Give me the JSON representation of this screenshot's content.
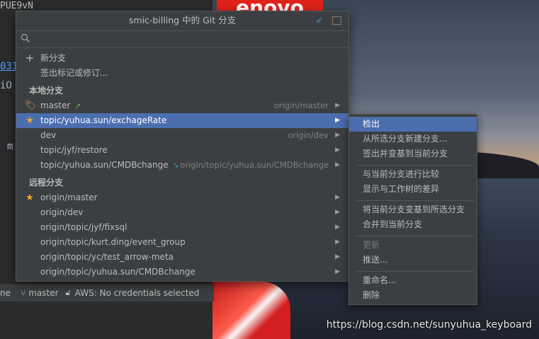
{
  "background": {
    "logo_text": "enovo",
    "ide_fragments": [
      "PUE9vN",
      "031",
      "iO",
      "m"
    ],
    "watermark": "https://blog.csdn.net/sunyuhua_keyboard"
  },
  "statusbar": {
    "left_fragment": "ne",
    "branch": "master",
    "aws": "AWS: No credentials selected"
  },
  "popup": {
    "title": "smic-billing 中的 Git 分支",
    "search": {
      "value": "",
      "placeholder": ""
    },
    "actions": [
      {
        "icon": "plus-icon",
        "label": "新分支"
      },
      {
        "icon": "none",
        "label": "签出标记或修订..."
      }
    ],
    "local_header": "本地分支",
    "local_branches": [
      {
        "icon": "tag-icon",
        "label": "master",
        "marker": "up-arrow-icon",
        "tracking": "origin/master"
      },
      {
        "icon": "star-icon",
        "label": "topic/yuhua.sun/exchageRate",
        "marker": "",
        "tracking": "",
        "selected": true
      },
      {
        "icon": "",
        "label": "dev",
        "marker": "",
        "tracking": "origin/dev"
      },
      {
        "icon": "",
        "label": "topic/jyf/restore",
        "marker": "",
        "tracking": ""
      },
      {
        "icon": "",
        "label": "topic/yuhua.sun/CMDBchange",
        "marker": "down-arrow-icon",
        "tracking": "origin/topic/yuhua.sun/CMDBchange"
      }
    ],
    "remote_header": "远程分支",
    "remote_branches": [
      {
        "icon": "star-icon",
        "label": "origin/master"
      },
      {
        "icon": "",
        "label": "origin/dev"
      },
      {
        "icon": "",
        "label": "origin/topic/jyf/fixsql"
      },
      {
        "icon": "",
        "label": "origin/topic/kurt.ding/event_group"
      },
      {
        "icon": "",
        "label": "origin/topic/yc/test_arrow-meta"
      },
      {
        "icon": "",
        "label": "origin/topic/yuhua.sun/CMDBchange"
      }
    ]
  },
  "submenu": {
    "items": [
      {
        "label": "检出",
        "selected": true
      },
      {
        "label": "从所选分支新建分支..."
      },
      {
        "label": "签出并变基到当前分支"
      },
      {
        "label": "与当前分支进行比较"
      },
      {
        "label": "显示与工作树的差异"
      },
      {
        "label": "将当前分支变基到所选分支"
      },
      {
        "label": "合并到当前分支"
      },
      {
        "label": "更新",
        "disabled": true
      },
      {
        "label": "推送..."
      },
      {
        "label": "重命名..."
      },
      {
        "label": "删除"
      }
    ]
  },
  "colors": {
    "popup_bg": "#3c3f41",
    "selection": "#4b6eaf",
    "star": "#f0a732",
    "incoming": "#3592c4",
    "outgoing": "#5faf5f"
  }
}
